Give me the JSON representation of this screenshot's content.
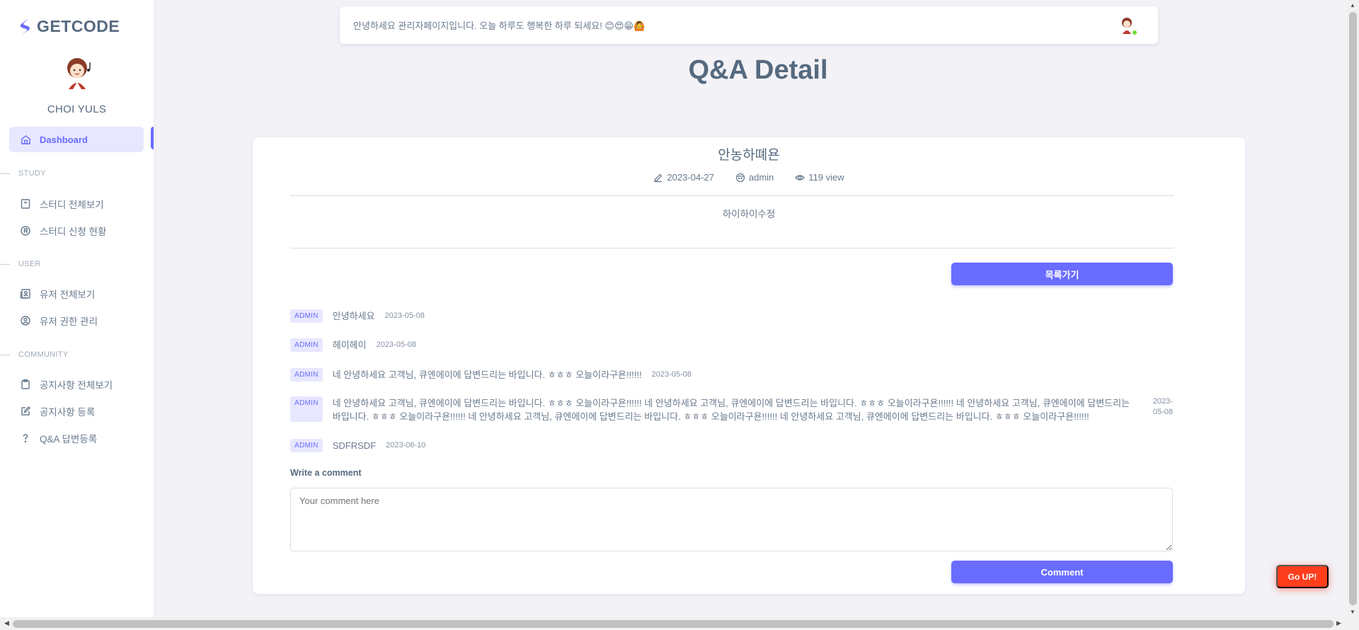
{
  "brand": {
    "name": "GETCODE"
  },
  "profile": {
    "name": "CHOI YULS"
  },
  "sidebar": {
    "active": {
      "label": "Dashboard"
    },
    "sections": [
      {
        "header": "STUDY",
        "items": [
          {
            "label": "스터디 전체보기"
          },
          {
            "label": "스터디 신청 현황"
          }
        ]
      },
      {
        "header": "USER",
        "items": [
          {
            "label": "유저 전체보기"
          },
          {
            "label": "유저 권한 관리"
          }
        ]
      },
      {
        "header": "COMMUNITY",
        "items": [
          {
            "label": "공지사항 전체보기"
          },
          {
            "label": "공지사항 등록"
          },
          {
            "label": "Q&A 답변등록"
          }
        ]
      }
    ]
  },
  "topbar": {
    "message": "안녕하세요 관리자페이지입니다. 오늘 하루도 행복한 하루 되세요! 😊😍😁🙆"
  },
  "page": {
    "title": "Q&A Detail"
  },
  "post": {
    "title": "안농하뗴욘",
    "date": "2023-04-27",
    "author": "admin",
    "views": "119 view",
    "content": "하이하이수정",
    "list_button": "목록가기"
  },
  "comments": [
    {
      "badge": "ADMIN",
      "text": "안녕하세요",
      "date": "2023-05-08"
    },
    {
      "badge": "ADMIN",
      "text": "헤이헤이",
      "date": "2023-05-08"
    },
    {
      "badge": "ADMIN",
      "text": "네 안녕하세요 고객님, 큐엔에이에 답변드리는 바입니다. ㅎㅎㅎ 오늘이라구욘!!!!!!",
      "date": "2023-05-08"
    },
    {
      "badge": "ADMIN",
      "text": "네 안녕하세요 고객님, 큐엔에이에 답변드리는 바입니다. ㅎㅎㅎ 오늘이라구욘!!!!!! 네 안녕하세요 고객님, 큐엔에이에 답변드리는 바입니다. ㅎㅎㅎ 오늘이라구욘!!!!!! 네 안녕하세요 고객님, 큐엔에이에 답변드리는 바입니다. ㅎㅎㅎ 오늘이라구욘!!!!!! 네 안녕하세요 고객님, 큐엔에이에 답변드리는 바입니다. ㅎㅎㅎ 오늘이라구욘!!!!!! 네 안녕하세요 고객님, 큐엔에이에 답변드리는 바입니다. ㅎㅎㅎ 오늘이라구욘!!!!!!",
      "date": "2023-05-08"
    },
    {
      "badge": "ADMIN",
      "text": "SDFRSDF",
      "date": "2023-06-10"
    }
  ],
  "comment_form": {
    "label": "Write a comment",
    "placeholder": "Your comment here",
    "submit": "Comment"
  },
  "go_up": "Go UP!",
  "colors": {
    "accent": "#696cff",
    "danger": "#ff3e1d",
    "online": "#71dd37"
  }
}
